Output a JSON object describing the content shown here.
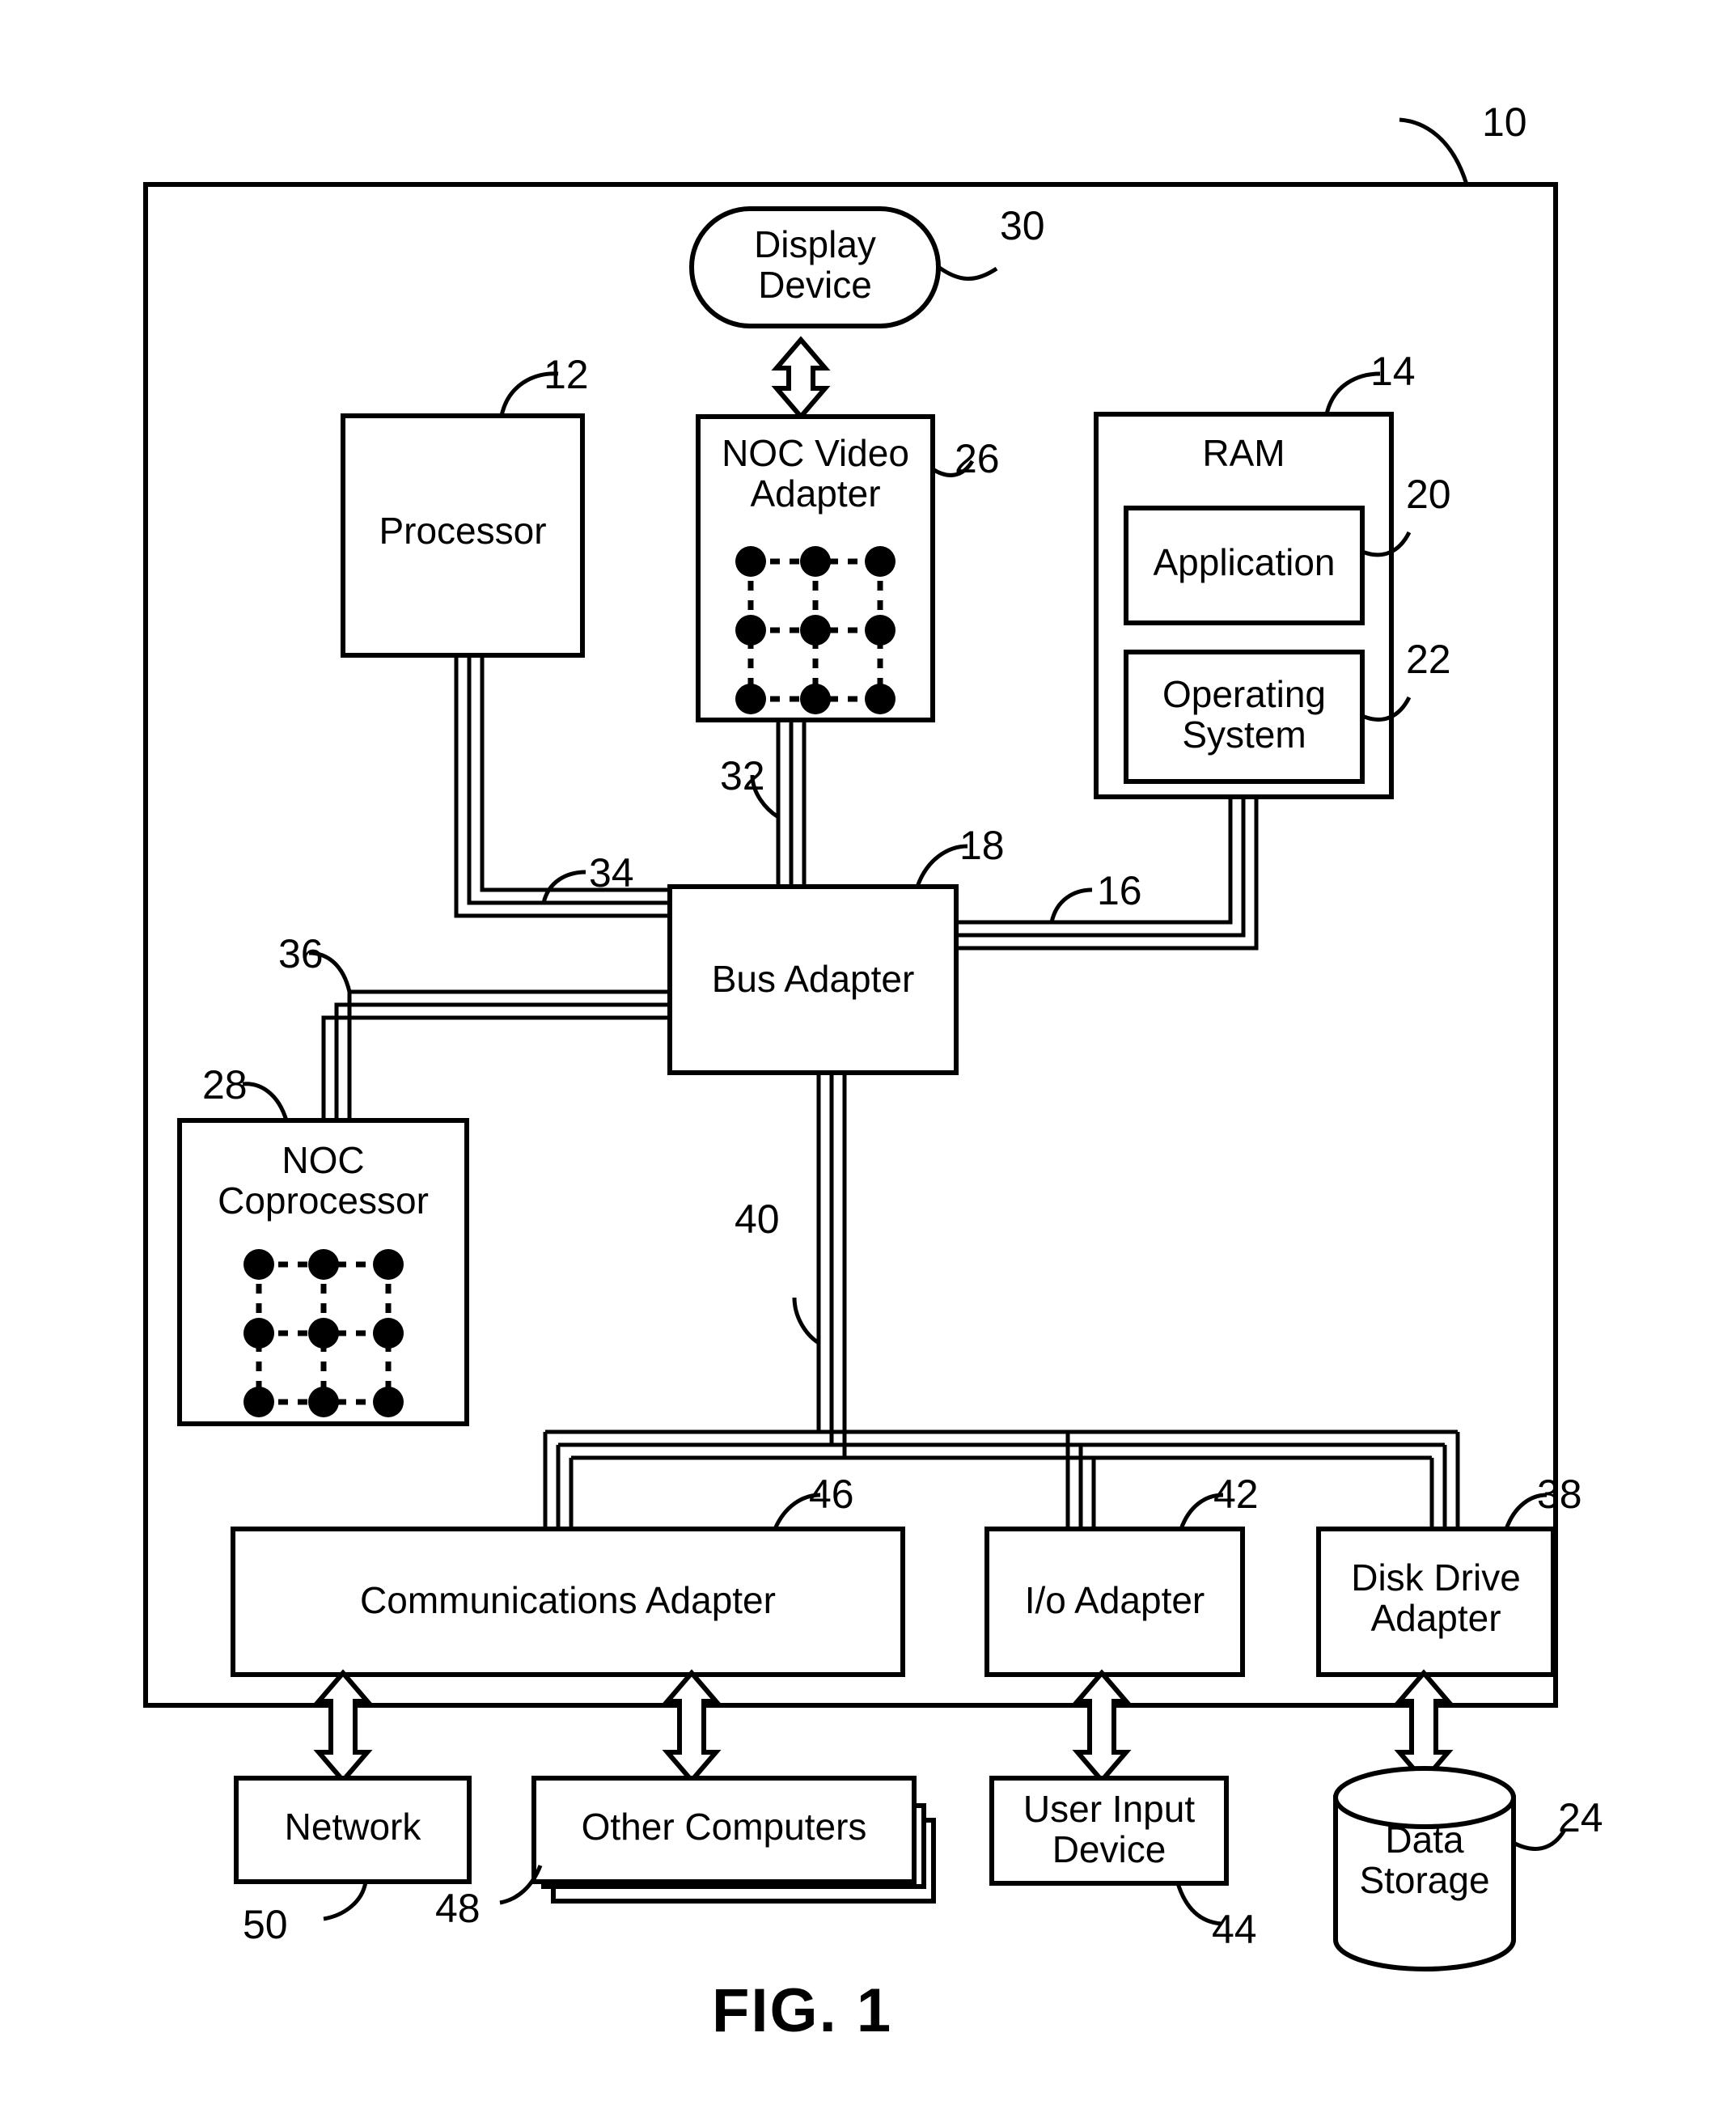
{
  "figure": {
    "caption": "FIG. 1",
    "outer_frame_ref": "10"
  },
  "nodes": [
    {
      "id": "display-device",
      "label": "Display\nDevice",
      "ref": "30",
      "shape": "stadium"
    },
    {
      "id": "processor",
      "label": "Processor",
      "ref": "12",
      "shape": "rect"
    },
    {
      "id": "noc-video-adapter",
      "label": "NOC Video\nAdapter",
      "ref": "26",
      "shape": "rect-mesh"
    },
    {
      "id": "ram",
      "label": "RAM",
      "ref": "14",
      "shape": "rect"
    },
    {
      "id": "application",
      "label": "Application",
      "ref": "20",
      "shape": "rect"
    },
    {
      "id": "operating-system",
      "label": "Operating\nSystem",
      "ref": "22",
      "shape": "rect"
    },
    {
      "id": "bus-adapter",
      "label": "Bus Adapter",
      "ref": "18",
      "shape": "rect"
    },
    {
      "id": "noc-coprocessor",
      "label": "NOC\nCoprocessor",
      "ref": "28",
      "shape": "rect-mesh"
    },
    {
      "id": "communications-adapter",
      "label": "Communications Adapter",
      "ref": "46",
      "shape": "rect"
    },
    {
      "id": "io-adapter",
      "label": "I/o Adapter",
      "ref": "42",
      "shape": "rect"
    },
    {
      "id": "disk-drive-adapter",
      "label": "Disk Drive\nAdapter",
      "ref": "38",
      "shape": "rect"
    },
    {
      "id": "network",
      "label": "Network",
      "ref": "50",
      "shape": "rect"
    },
    {
      "id": "other-computers",
      "label": "Other Computers",
      "ref": "48",
      "shape": "rect-stack"
    },
    {
      "id": "user-input-device",
      "label": "User Input\nDevice",
      "ref": "44",
      "shape": "rect"
    },
    {
      "id": "data-storage",
      "label": "Data\nStorage",
      "ref": "24",
      "shape": "cylinder"
    }
  ],
  "bus_refs": [
    {
      "id": "video-bus",
      "ref": "32"
    },
    {
      "id": "front-side-bus",
      "ref": "34"
    },
    {
      "id": "memory-bus",
      "ref": "16"
    },
    {
      "id": "coprocessor-bus",
      "ref": "36"
    },
    {
      "id": "expansion-bus",
      "ref": "40"
    }
  ],
  "colors": {
    "stroke": "#000000",
    "fill": "#ffffff"
  }
}
